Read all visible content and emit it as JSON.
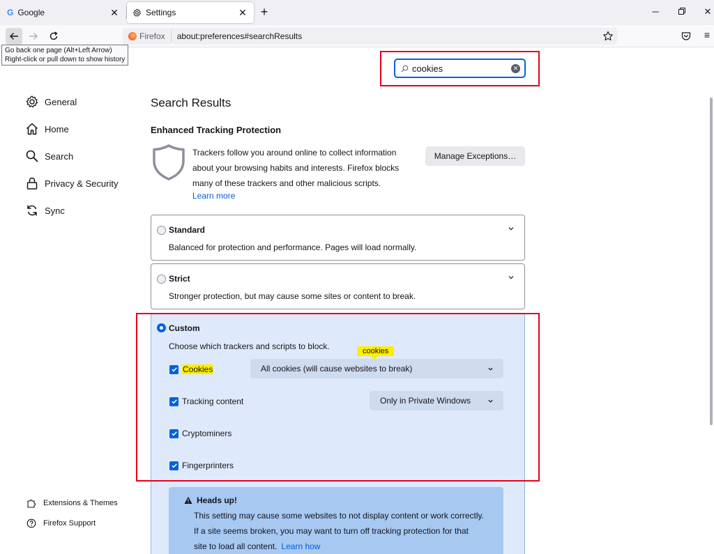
{
  "tabs": [
    {
      "title": "Google",
      "icon": "google-icon"
    },
    {
      "title": "Settings",
      "icon": "gear-icon",
      "active": true
    }
  ],
  "nav": {
    "identity_label": "Firefox",
    "url": "about:preferences#searchResults",
    "back_tooltip_line1": "Go back one page (Alt+Left Arrow)",
    "back_tooltip_line2": "Right-click or pull down to show history"
  },
  "search": {
    "value": "cookies"
  },
  "sidebar": {
    "items": [
      {
        "label": "General",
        "icon": "gear-icon"
      },
      {
        "label": "Home",
        "icon": "home-icon"
      },
      {
        "label": "Search",
        "icon": "search-icon"
      },
      {
        "label": "Privacy & Security",
        "icon": "lock-icon"
      },
      {
        "label": "Sync",
        "icon": "sync-icon"
      }
    ],
    "footer": [
      {
        "label": "Extensions & Themes",
        "icon": "puzzle-icon"
      },
      {
        "label": "Firefox Support",
        "icon": "help-icon"
      }
    ]
  },
  "main": {
    "results_title": "Search Results",
    "etp_heading": "Enhanced Tracking Protection",
    "etp_desc_lines": [
      "Trackers follow you around online to collect information",
      "about your browsing habits and interests. Firefox blocks",
      "many of these trackers and other malicious scripts."
    ],
    "learn_more": "Learn more",
    "manage_exceptions": "Manage Exceptions…",
    "options": {
      "standard": {
        "title": "Standard",
        "desc": "Balanced for protection and performance. Pages will load normally."
      },
      "strict": {
        "title": "Strict",
        "desc": "Stronger protection, but may cause some sites or content to break."
      },
      "custom": {
        "title": "Custom",
        "desc": "Choose which trackers and scripts to block.",
        "selected": true
      }
    },
    "custom_items": [
      {
        "label": "Cookies",
        "checked": true
      },
      {
        "label": "Tracking content",
        "checked": true
      },
      {
        "label": "Cryptominers",
        "checked": true
      },
      {
        "label": "Fingerprinters",
        "checked": true
      }
    ],
    "cookies_select": "All cookies (will cause websites to break)",
    "tracking_select": "Only in Private Windows",
    "search_tip": "cookies",
    "warning": {
      "title": "Heads up!",
      "lines": [
        "This setting may cause some websites to not display content or work correctly.",
        "If a site seems broken, you may want to turn off tracking protection for that",
        "site to load all content."
      ],
      "link": "Learn how"
    }
  },
  "colors": {
    "accent": "#0061e0",
    "highlight": "#ffee00",
    "annotation": "#e3001b",
    "custom_bg": "#deeafc"
  }
}
